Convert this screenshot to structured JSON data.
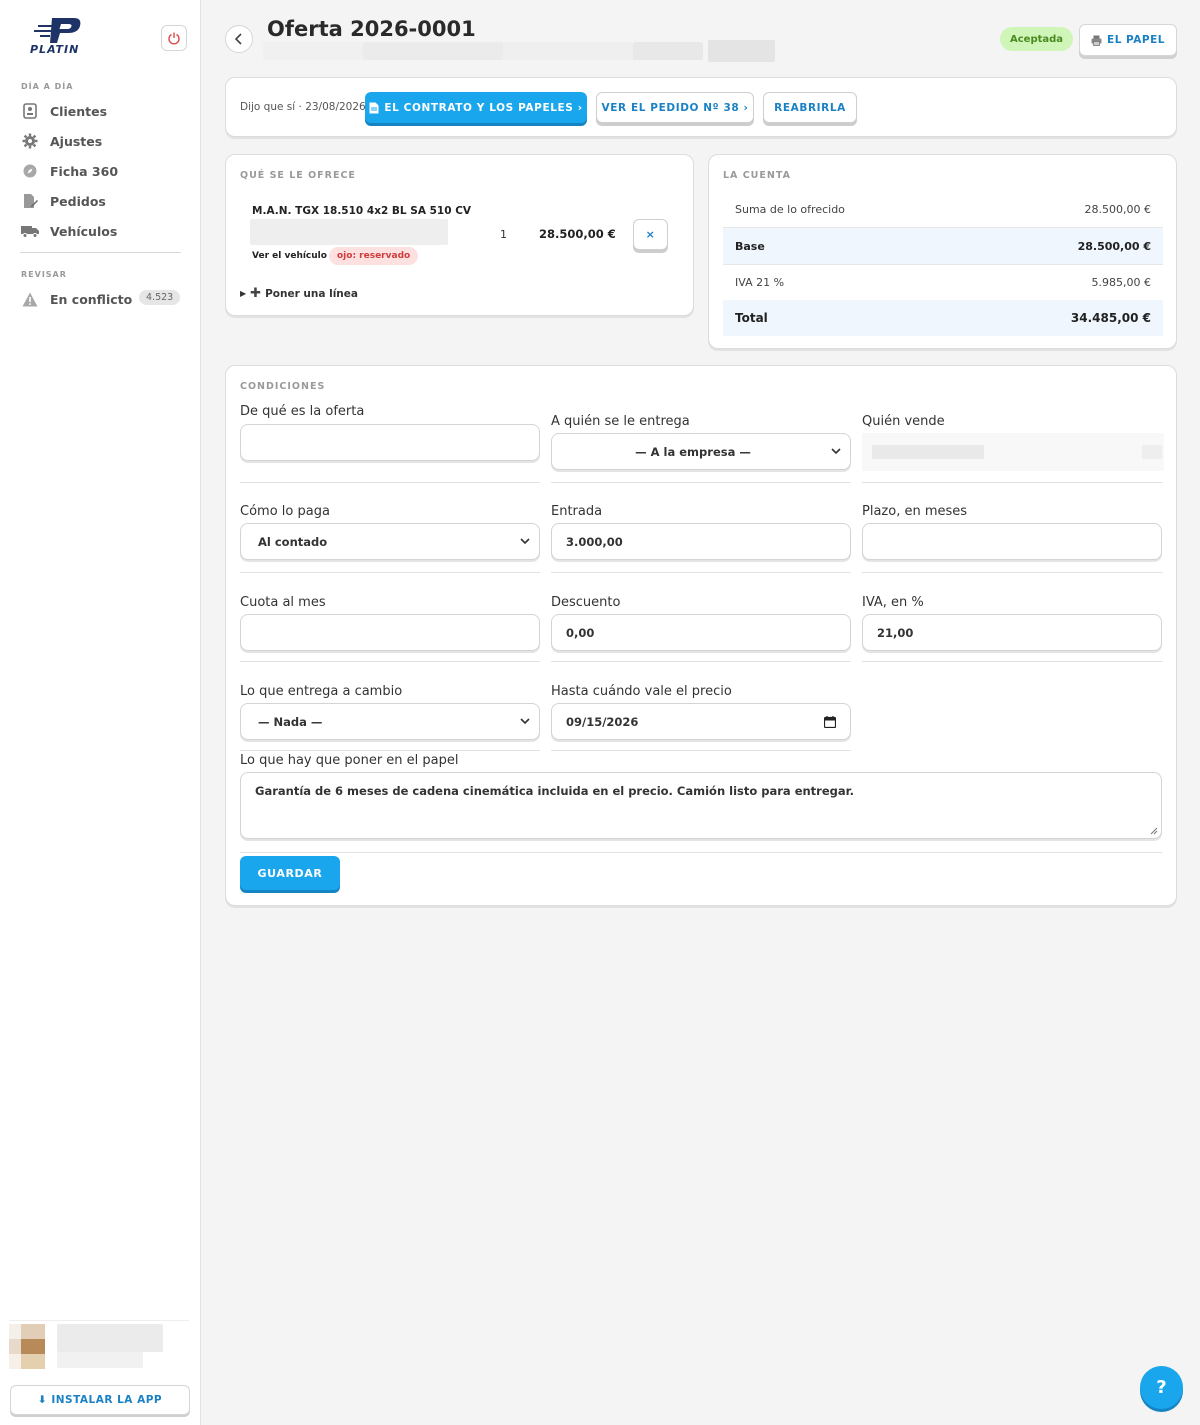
{
  "sidebar": {
    "brand": "PLATIN",
    "section_daily": "DÍA A DÍA",
    "items": [
      {
        "label": "Clientes"
      },
      {
        "label": "Ajustes"
      },
      {
        "label": "Ficha 360"
      },
      {
        "label": "Pedidos"
      },
      {
        "label": "Vehículos"
      }
    ],
    "section_review": "REVISAR",
    "conflict_label": "En conflicto",
    "conflict_count": "4.523",
    "install_label": "⬇ INSTALAR LA APP"
  },
  "header": {
    "title": "Oferta 2026-0001",
    "status": "Aceptada",
    "paper_label": "EL PAPEL"
  },
  "actions": {
    "accepted_text": "Dijo que sí · 23/08/2026",
    "contract_label": "EL CONTRATO Y LOS PAPELES ›",
    "order_label": "VER EL PEDIDO Nº 38 ›",
    "reopen_label": "REABRIRLA"
  },
  "offer": {
    "title": "QUÉ SE LE OFRECE",
    "line": {
      "name": "M.A.N. TGX 18.510 4x2 BL SA 510 CV",
      "qty": "1",
      "price": "28.500,00 €",
      "vehicle_link": "Ver el vehículo ›",
      "reserved_tag": "ojo: reservado"
    },
    "add_line": "Poner una línea"
  },
  "account": {
    "title": "LA CUENTA",
    "rows": [
      {
        "label": "Suma de lo ofrecido",
        "value": "28.500,00 €"
      },
      {
        "label": "Base",
        "value": "28.500,00 €"
      },
      {
        "label": "IVA 21 %",
        "value": "5.985,00 €"
      },
      {
        "label": "Total",
        "value": "34.485,00 €"
      }
    ]
  },
  "conditions": {
    "title": "CONDICIONES",
    "offer_about_label": "De qué es la oferta",
    "offer_about_value": "",
    "deliver_to_label": "A quién se le entrega",
    "deliver_to_value": "— A la empresa —",
    "seller_label": "Quién vende",
    "payment_label": "Cómo lo paga",
    "payment_value": "Al contado",
    "down_label": "Entrada",
    "down_value": "3.000,00",
    "term_label": "Plazo, en meses",
    "term_value": "",
    "monthly_label": "Cuota al mes",
    "monthly_value": "",
    "discount_label": "Descuento",
    "discount_value": "0,00",
    "vat_label": "IVA, en %",
    "vat_value": "21,00",
    "tradein_label": "Lo que entrega a cambio",
    "tradein_value": "— Nada —",
    "valid_label": "Hasta cuándo vale el precio",
    "valid_value": "09/15/2026",
    "notes_label": "Lo que hay que poner en el papel",
    "notes_value": "Garantía de 6 meses de cadena cinemática incluida en el precio. Camión listo para entregar.",
    "save_label": "GUARDAR"
  },
  "help_label": "?"
}
